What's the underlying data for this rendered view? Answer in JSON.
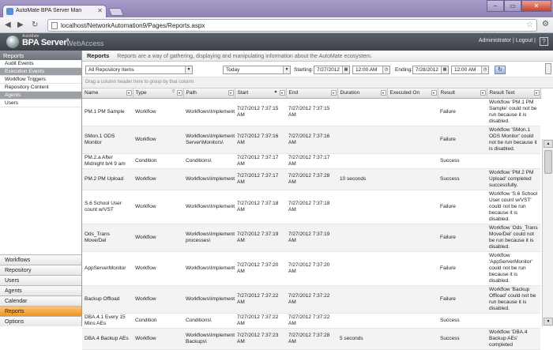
{
  "browser": {
    "tab_title": "AutoMate BPA Server Man",
    "url": "localhost/NetworkAutomation9/Pages/Reports.aspx"
  },
  "app": {
    "logo_small": "AutoMate",
    "logo_main": "BPA Server",
    "logo_version": "9",
    "logo_web": "WebAccess",
    "user_links": "Administrator | Logout |"
  },
  "sidebar": {
    "title": "Reports",
    "items": [
      "Audit Events",
      "Execution Events",
      "Workflow Triggers",
      "Repository Content",
      "Agents",
      "Users"
    ],
    "selected": [
      1,
      4
    ],
    "nav": [
      "Workflows",
      "Repository",
      "Users",
      "Agents",
      "Calendar",
      "Reports",
      "Options"
    ],
    "nav_active": 5
  },
  "main": {
    "title": "Reports",
    "description": "Reports are a way of gathering, displaying and manipulating information about the AutoMate ecosystem.",
    "filter_scope": "All Repository Items",
    "filter_range": "Today",
    "starting_label": "Starting:",
    "start_date": "7/27/2012",
    "start_time": "12:00 AM",
    "ending_label": "Ending:",
    "end_date": "7/28/2012",
    "end_time": "12:00 AM",
    "group_hint": "Drag a column header here to group by that column"
  },
  "table": {
    "columns": [
      "Name",
      "Type",
      "Path",
      "Start",
      "End",
      "Duration",
      "Executed On",
      "Result",
      "Result Text"
    ],
    "rows": [
      [
        "PM.1 PM Sample",
        "Workflow",
        "Workflows\\Implementa",
        "7/27/2012 7:37:15 AM",
        "7/27/2012 7:37:15 AM",
        "",
        "",
        "Failure",
        "Workflow 'PM.1 PM Sample' could not be run because it is disabled."
      ],
      [
        "SMon.1 ODS Monitor",
        "Workflow",
        "Workflows\\Implementa Server\\Monitors\\",
        "7/27/2012 7:37:16 AM",
        "7/27/2012 7:37:16 AM",
        "",
        "",
        "Failure",
        "Workflow 'SMon.1 ODS Monitor' could not be run because it is disabled."
      ],
      [
        "PM.2.a After Midnight b/4 9 am",
        "Condition",
        "Conditions\\",
        "7/27/2012 7:37:17 AM",
        "7/27/2012 7:37:17 AM",
        "",
        "",
        "Success",
        ""
      ],
      [
        "PM.2 PM Upload",
        "Workflow",
        "Workflows\\Implementa",
        "7/27/2012 7:37:17 AM",
        "7/27/2012 7:37:28 AM",
        "10 seconds",
        "",
        "Success",
        "Workflow 'PM.2 PM Upload' completed successfully."
      ],
      [
        "S.6 School User count w/VST",
        "Workflow",
        "Workflows\\Implementa",
        "7/27/2012 7:37:18 AM",
        "7/27/2012 7:37:18 AM",
        "",
        "",
        "Failure",
        "Workflow 'S.6 School User count w/VST' could not be run because it is disabled."
      ],
      [
        "Ods_Trans Move/Del",
        "Workflow",
        "Workflows\\Implementa processes\\",
        "7/27/2012 7:37:19 AM",
        "7/27/2012 7:37:19 AM",
        "",
        "",
        "Failure",
        "Workflow 'Ods_Trans Move/Del' could not be run because it is disabled."
      ],
      [
        "AppServerMonitor",
        "Workflow",
        "Workflows\\Implementa",
        "7/27/2012 7:37:20 AM",
        "7/27/2012 7:37:20 AM",
        "",
        "",
        "Failure",
        "Workflow 'AppServerMonitor' could not be run because it is disabled."
      ],
      [
        "Backup Offload",
        "Workflow",
        "Workflows\\Implementa",
        "7/27/2012 7:37:22 AM",
        "7/27/2012 7:37:22 AM",
        "",
        "",
        "Failure",
        "Workflow 'Backup Offload' could not be run because it is disabled."
      ],
      [
        "DBA.4.1 Every 15 Mins AEs",
        "Condition",
        "Conditions\\",
        "7/27/2012 7:37:22 AM",
        "7/27/2012 7:37:22 AM",
        "",
        "",
        "Success",
        ""
      ],
      [
        "DBA.4 Backup AEs",
        "Workflow",
        "Workflows\\Implementa Backups\\",
        "7/27/2012 7:37:23 AM",
        "7/27/2012 7:37:28 AM",
        "5 seconds",
        "",
        "Success",
        "Workflow 'DBA.4 Backup AEs' completed"
      ]
    ]
  }
}
